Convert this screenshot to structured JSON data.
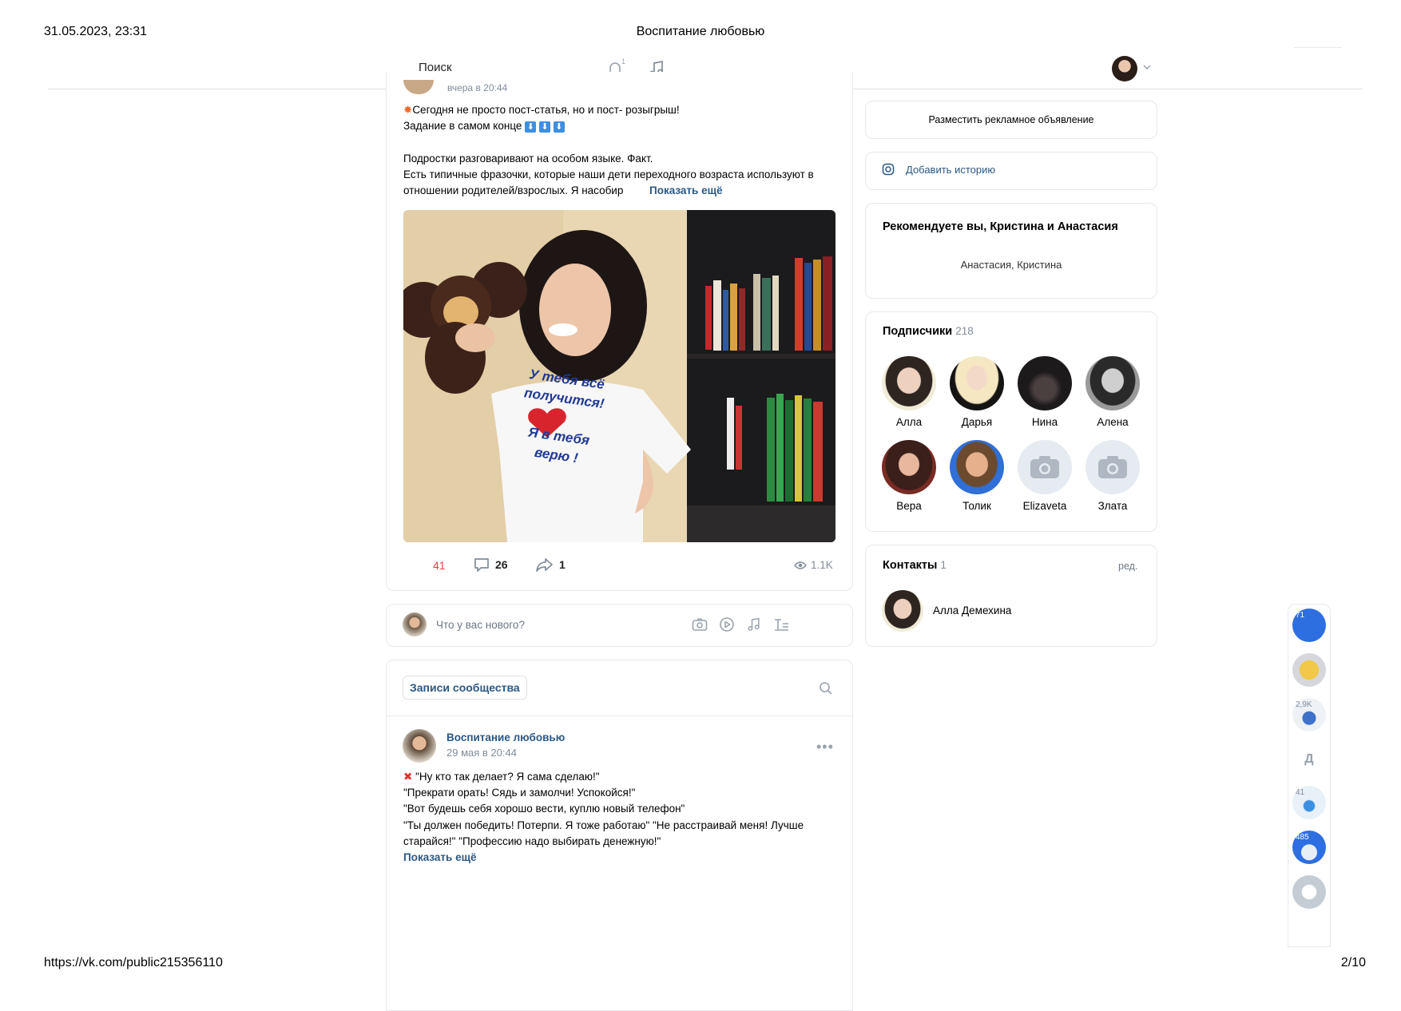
{
  "print": {
    "datetime": "31.05.2023, 23:31",
    "title": "Воспитание любовью",
    "url": "https://vk.com/public215356110",
    "page": "2/10"
  },
  "topbar": {
    "search_label": "Поиск",
    "notification_count": "1"
  },
  "post1": {
    "time_partial": "вчера в 20:44",
    "line1": "Сегодня не просто пост-статья, но и пост- розыгрыш!",
    "line2": "Задание в самом конце",
    "line3": "Подростки разговаривают на особом языке. Факт.",
    "line4": "Есть типичные фразочки, которые наши дети переходного возраста используют в",
    "line5": "отношении родителей/взрослых. Я насобир",
    "show_more": "Показать ещё",
    "shirt_text": [
      "У тебя всё",
      "получится!",
      "Я в тебя",
      "верю !"
    ],
    "likes": "41",
    "comments": "26",
    "shares": "1",
    "views": "1.1K"
  },
  "composer": {
    "placeholder": "Что у вас нового?"
  },
  "wall": {
    "tab_label": "Записи сообщества"
  },
  "post2": {
    "author": "Воспитание любовью",
    "date": "29 мая в 20:44",
    "lines": [
      "\"Ну кто так делает? Я сама сделаю!\"",
      "\"Прекрати орать! Сядь и замолчи! Успокойся!\"",
      "\"Вот будешь себя хорошо вести, куплю новый телефон\"",
      "\"Ты должен победить! Потерпи. Я тоже работаю\" \"Не расстраивай меня! Лучше",
      "старайся!\" \"Профессию надо выбирать денежную!\""
    ],
    "show_more": "Показать ещё"
  },
  "right": {
    "ad_label": "Разместить рекламное объявление",
    "story_label": "Добавить историю",
    "recommend_title": "Рекомендуете вы, Кристина и Анастасия",
    "recommend_names": "Анастасия, Кристина",
    "subscribers_title": "Подписчики",
    "subscribers_count": "218",
    "subscribers": [
      "Алла",
      "Дарья",
      "Нина",
      "Алена",
      "Вера",
      "Толик",
      "Elizaveta",
      "Злата"
    ],
    "contacts_title": "Контакты",
    "contacts_count": "1",
    "contacts_edit": "ред.",
    "contact_name": "Алла Демехина"
  },
  "sidebar": {
    "badges": [
      "71",
      "2,9K",
      "41",
      "485"
    ],
    "letter": "Д"
  },
  "colors": {
    "link": "#2a5885",
    "like_red": "#e64646",
    "muted": "#818c99",
    "border": "#e7e8ec"
  }
}
